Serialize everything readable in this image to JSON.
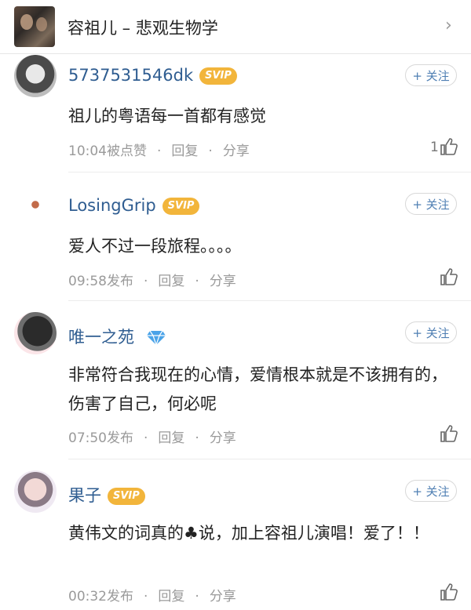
{
  "header": {
    "title": "容祖儿 – 悲观生物学",
    "chevron_icon": "chevron-right-icon"
  },
  "comments": [
    {
      "user": "5737531546dk",
      "badge": "SVIP",
      "follow": "+ 关注",
      "text": "祖儿的粤语每一首都有感觉",
      "time": "10:04被点赞",
      "reply": "回复",
      "share": "分享",
      "likes": "1"
    },
    {
      "user": "LosingGrip",
      "badge": "SVIP",
      "follow": "+ 关注",
      "text": "爱人不过一段旅程。。。。",
      "time": "09:58发布",
      "reply": "回复",
      "share": "分享",
      "likes": ""
    },
    {
      "user": "唯一之苑",
      "badge": "diamond",
      "follow": "+ 关注",
      "text": "非常符合我现在的心情，爱情根本就是不该拥有的，伤害了自己，何必呢",
      "time": "07:50发布",
      "reply": "回复",
      "share": "分享",
      "likes": ""
    },
    {
      "user": "果子",
      "badge": "SVIP",
      "follow": "+ 关注",
      "text": "黄伟文的词真的♣说，加上容祖儿演唱！爱了！！",
      "time": "00:32发布",
      "reply": "回复",
      "share": "分享",
      "likes": ""
    }
  ],
  "colors": {
    "username": "#2f5d91",
    "svip": "#f2b53b",
    "follow": "#4f7fb3",
    "meta": "#9a9a9a"
  }
}
